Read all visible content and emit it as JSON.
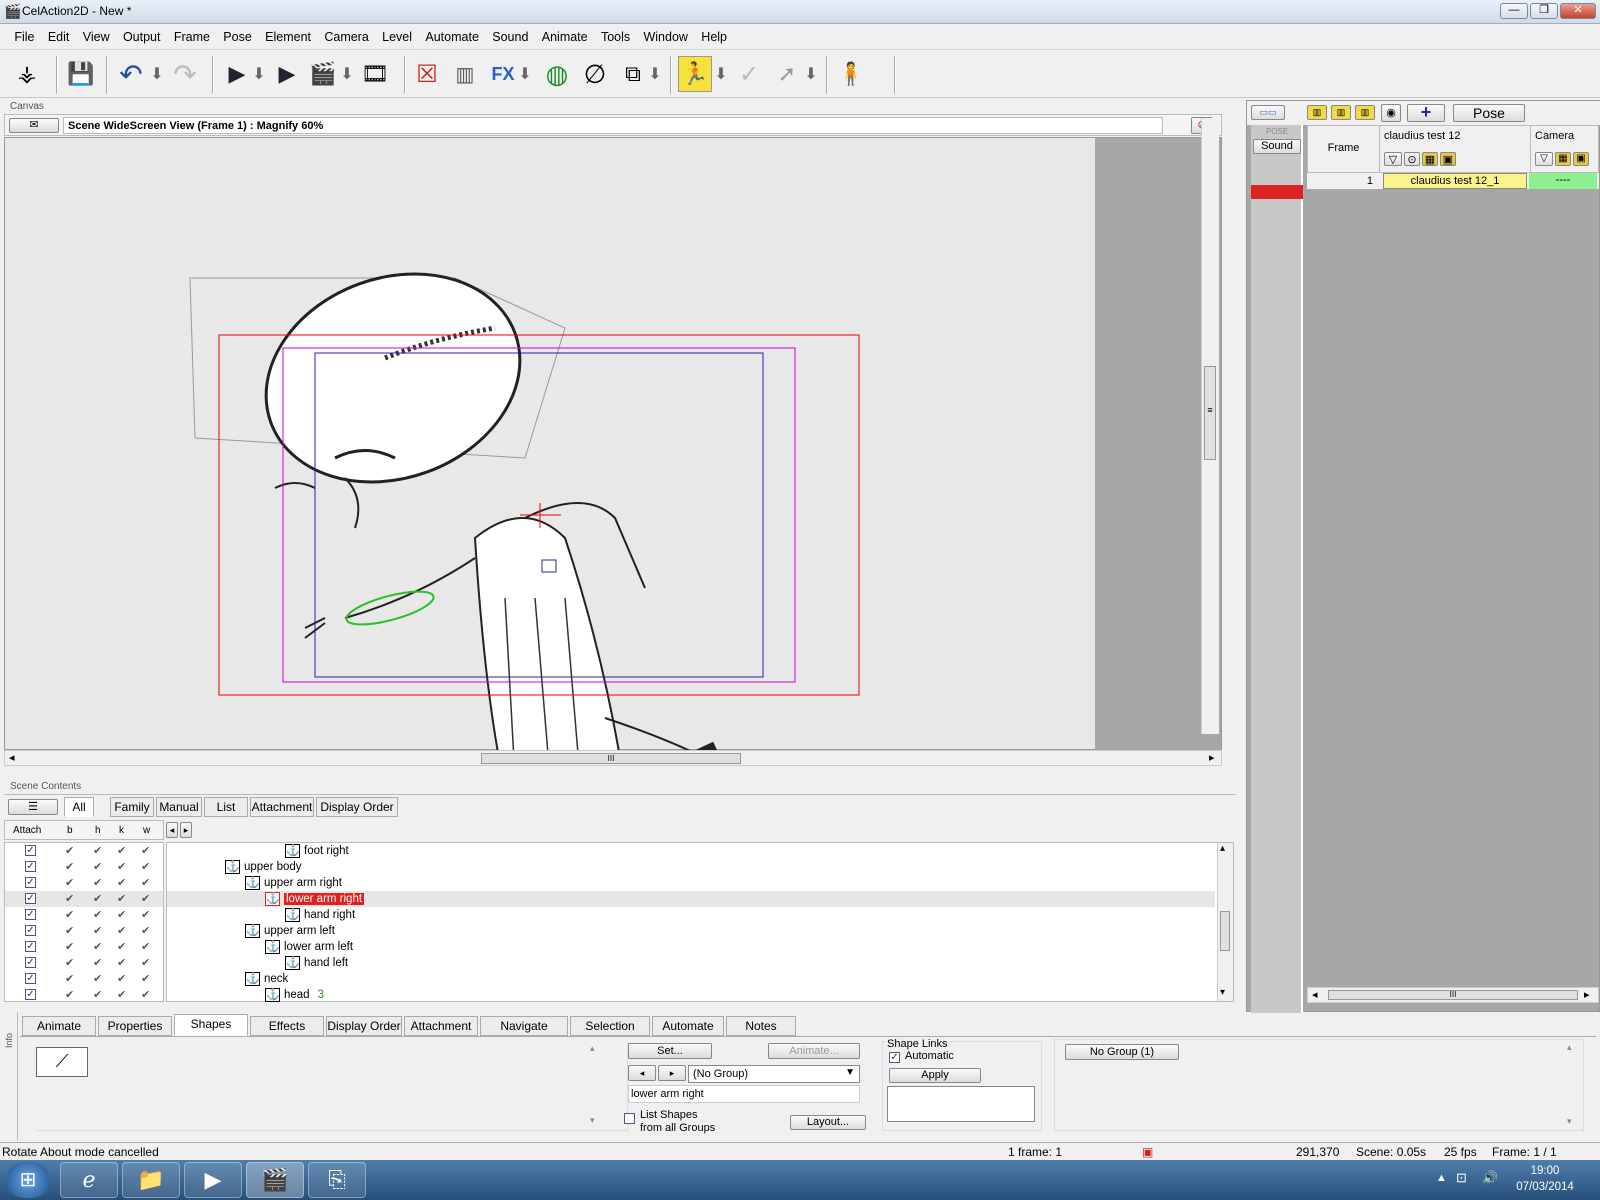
{
  "window": {
    "title": "CelAction2D - New *",
    "minimize": "—",
    "maximize": "❐",
    "close": "✕"
  },
  "menu": [
    "File",
    "Edit",
    "View",
    "Output",
    "Frame",
    "Pose",
    "Element",
    "Camera",
    "Level",
    "Automate",
    "Sound",
    "Animate",
    "Tools",
    "Window",
    "Help"
  ],
  "canvas": {
    "panel_label": "Canvas",
    "view_info": "Scene WideScreen View (Frame 1) : Magnify 60%",
    "h_scroll_grip": "III",
    "v_scroll_grip": "≡"
  },
  "timeline": {
    "pose_button": "Pose",
    "pose_small": "POSE",
    "sound_button": "Sound",
    "add_symbol": "+",
    "frame_header": "Frame",
    "element_header": "claudius test 12",
    "camera_header": "Camera",
    "rows": [
      {
        "frame": "1",
        "element": "claudius test 12_1",
        "camera": "----"
      }
    ],
    "h_scroll_grip": "III"
  },
  "scene_contents": {
    "panel_label": "Scene Contents",
    "tabs": [
      "All",
      "Family",
      "Manual",
      "List",
      "Attachment",
      "Display Order"
    ],
    "active_tab": "All",
    "columns": [
      "Attach",
      "b",
      "h",
      "k",
      "w"
    ],
    "tree": [
      {
        "label": "foot right",
        "depth": 3,
        "suffix": ""
      },
      {
        "label": "upper body",
        "depth": 0,
        "suffix": ""
      },
      {
        "label": "upper arm right",
        "depth": 1,
        "suffix": ""
      },
      {
        "label": "lower arm right",
        "depth": 2,
        "suffix": "",
        "selected": true
      },
      {
        "label": "hand right",
        "depth": 3,
        "suffix": ""
      },
      {
        "label": "upper arm left",
        "depth": 1,
        "suffix": ""
      },
      {
        "label": "lower arm left",
        "depth": 2,
        "suffix": ""
      },
      {
        "label": "hand left",
        "depth": 3,
        "suffix": ""
      },
      {
        "label": "neck",
        "depth": 1,
        "suffix": ""
      },
      {
        "label": "head",
        "depth": 2,
        "suffix": "3"
      }
    ]
  },
  "info_panel": {
    "side_label": "Info",
    "tabs": [
      "Animate",
      "Properties",
      "Shapes",
      "Effects",
      "Display Order",
      "Attachment",
      "Navigate",
      "Selection",
      "Automate",
      "Notes"
    ],
    "active_tab": "Shapes",
    "set_button": "Set...",
    "animate_button": "Animate...",
    "group_select": "(No Group)",
    "shape_name": "lower arm right",
    "list_shapes_label_1": "List Shapes",
    "list_shapes_label_2": "from all Groups",
    "layout_button": "Layout...",
    "shape_links_label": "Shape Links",
    "automatic_label": "Automatic",
    "apply_button": "Apply",
    "no_group_button": "No Group (1)"
  },
  "status": {
    "message": "Rotate About mode cancelled",
    "frames": "1 frame: 1",
    "coords": "291,370",
    "scene": "Scene: 0.05s",
    "fps": "25 fps",
    "frame": "Frame:  1 / 1"
  },
  "taskbar": {
    "time": "19:00",
    "date": "07/03/2014"
  }
}
